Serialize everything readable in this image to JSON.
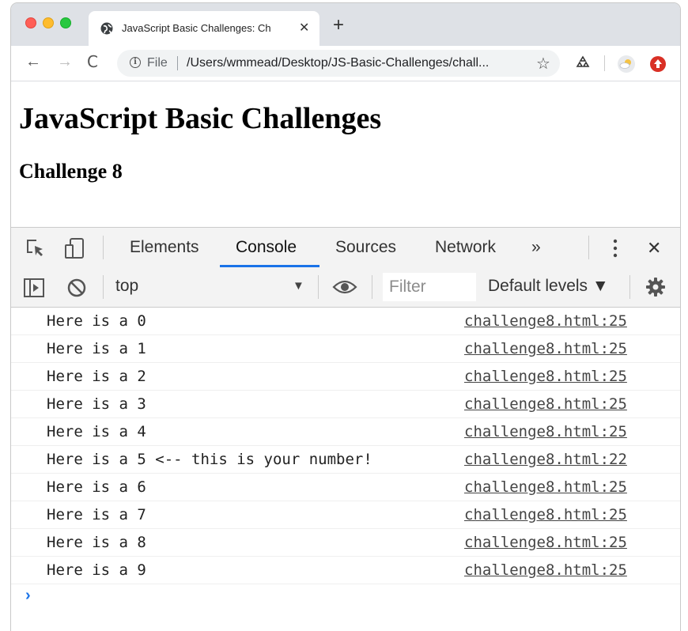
{
  "browser": {
    "tab_title": "JavaScript Basic Challenges: Ch",
    "tab_close": "✕",
    "new_tab": "+",
    "nav_back": "←",
    "nav_forward": "→",
    "nav_reload": "C",
    "address_scheme": "File",
    "address_url": "/Users/wmmead/Desktop/JS-Basic-Challenges/chall...",
    "bookmark_star": "☆"
  },
  "page": {
    "heading": "JavaScript Basic Challenges",
    "subheading": "Challenge 8"
  },
  "devtools": {
    "tabs": [
      {
        "label": "Elements"
      },
      {
        "label": "Console"
      },
      {
        "label": "Sources"
      },
      {
        "label": "Network"
      }
    ],
    "more_tabs": "»",
    "close": "✕",
    "context": "top",
    "filter_placeholder": "Filter",
    "levels": "Default levels ▼",
    "prompt": "›"
  },
  "console_logs": [
    {
      "message": "Here is a 0",
      "source": "challenge8.html:25"
    },
    {
      "message": "Here is a 1",
      "source": "challenge8.html:25"
    },
    {
      "message": "Here is a 2",
      "source": "challenge8.html:25"
    },
    {
      "message": "Here is a 3",
      "source": "challenge8.html:25"
    },
    {
      "message": "Here is a 4",
      "source": "challenge8.html:25"
    },
    {
      "message": "Here is a 5 <-- this is your number!",
      "source": "challenge8.html:22"
    },
    {
      "message": "Here is a 6",
      "source": "challenge8.html:25"
    },
    {
      "message": "Here is a 7",
      "source": "challenge8.html:25"
    },
    {
      "message": "Here is a 8",
      "source": "challenge8.html:25"
    },
    {
      "message": "Here is a 9",
      "source": "challenge8.html:25"
    }
  ],
  "colors": {
    "accent": "#1a73e8",
    "close_red": "#ff5f57",
    "minimize_yellow": "#febc2e",
    "zoom_green": "#28c840"
  }
}
